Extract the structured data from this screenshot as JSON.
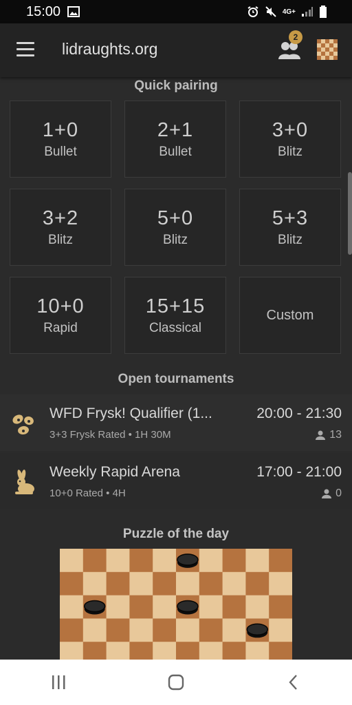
{
  "status_bar": {
    "time": "15:00",
    "network": "4G+"
  },
  "header": {
    "site_title": "lidraughts.org",
    "friends_badge": "2",
    "menu_icon": "hamburger-icon",
    "friends_icon": "friends-icon",
    "board_icon": "board-icon"
  },
  "quick_pairing": {
    "title": "Quick pairing",
    "options": [
      {
        "time": "1+0",
        "perf": "Bullet"
      },
      {
        "time": "2+1",
        "perf": "Bullet"
      },
      {
        "time": "3+0",
        "perf": "Blitz"
      },
      {
        "time": "3+2",
        "perf": "Blitz"
      },
      {
        "time": "5+0",
        "perf": "Blitz"
      },
      {
        "time": "5+3",
        "perf": "Blitz"
      },
      {
        "time": "10+0",
        "perf": "Rapid"
      },
      {
        "time": "15+15",
        "perf": "Classical"
      }
    ],
    "custom_label": "Custom"
  },
  "tournaments": {
    "title": "Open tournaments",
    "items": [
      {
        "name": "WFD Frysk! Qualifier (1...",
        "info": "3+3 Frysk Rated • 1H 30M",
        "time": "20:00 - 21:30",
        "players": "13",
        "icon": "frysk-icon"
      },
      {
        "name": "Weekly Rapid Arena",
        "info": "10+0 Rated • 4H",
        "time": "17:00 - 21:00",
        "players": "0",
        "icon": "rabbit-icon"
      }
    ]
  },
  "puzzle": {
    "title": "Puzzle of the day"
  },
  "colors": {
    "background": "#2b2b2b",
    "accent": "#c79a46",
    "board_light": "#e8c89a",
    "board_dark": "#b5733f"
  }
}
